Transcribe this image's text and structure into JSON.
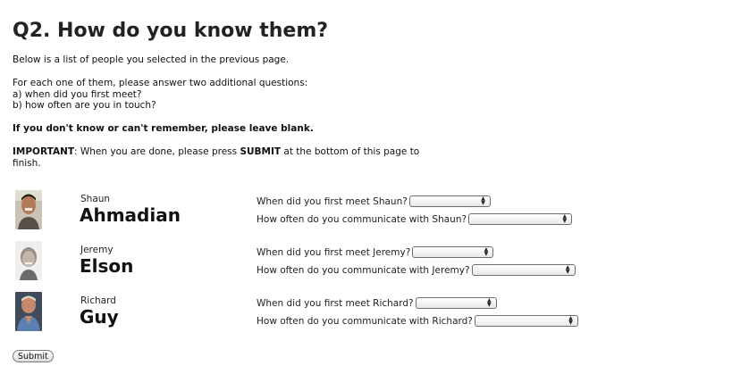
{
  "page": {
    "title": "Q2. How do you know them?",
    "intro": "Below is a list of people you selected in the previous page.",
    "foreach_line1": "For each one of them, please answer two additional questions:",
    "foreach_line2": "a) when did you first meet?",
    "foreach_line3": "b) how often are you in touch?",
    "blank_note": "If you don't know or can't remember, please leave blank.",
    "important_label": "IMPORTANT",
    "important_part1": ": When you are done, please press ",
    "important_submit": "SUBMIT",
    "important_part2": " at the bottom of this page to finish."
  },
  "people": [
    {
      "first_name": "Shaun",
      "last_name": "Ahmadian",
      "q_first_meet": "When did you first meet Shaun?",
      "q_how_often": "How often do you communicate with Shaun?",
      "first_meet_value": "",
      "how_often_value": ""
    },
    {
      "first_name": "Jeremy",
      "last_name": "Elson",
      "q_first_meet": "When did you first meet Jeremy?",
      "q_how_often": "How often do you communicate with Jeremy?",
      "first_meet_value": "",
      "how_often_value": ""
    },
    {
      "first_name": "Richard",
      "last_name": "Guy",
      "q_first_meet": "When did you first meet Richard?",
      "q_how_often": "How often do you communicate with Richard?",
      "first_meet_value": "",
      "how_often_value": ""
    }
  ],
  "submit_label": "Submit",
  "icons": {
    "select_arrows": "up-down-arrows-icon"
  }
}
